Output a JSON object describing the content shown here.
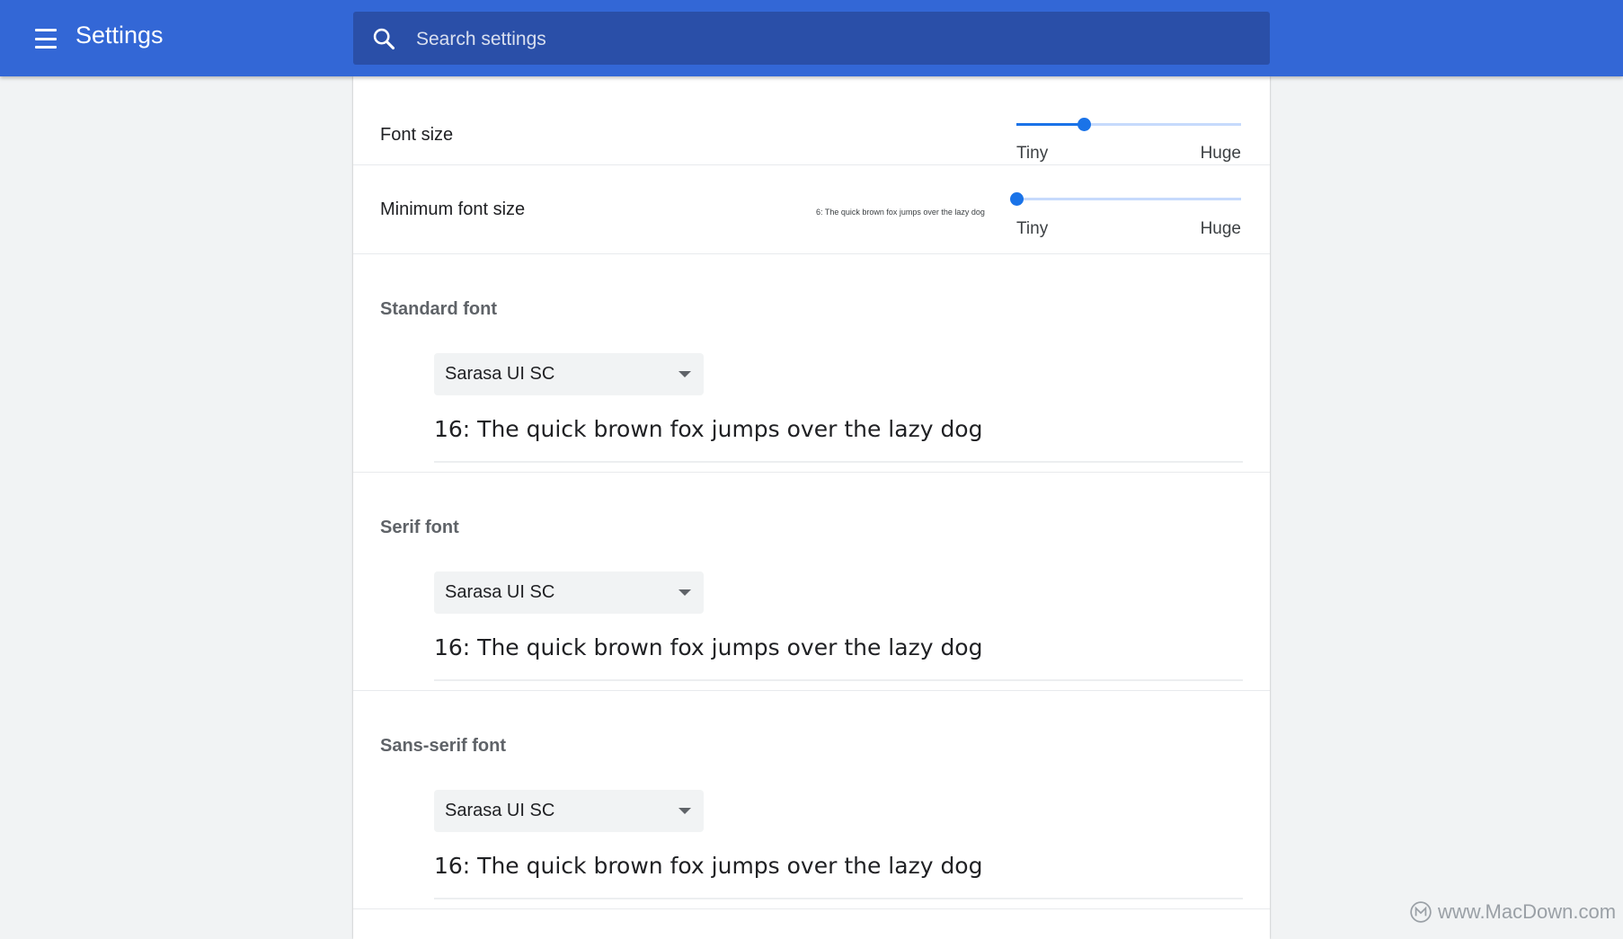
{
  "header": {
    "title": "Settings",
    "search_placeholder": "Search settings"
  },
  "font_size": {
    "label": "Font size",
    "min_label": "Tiny",
    "max_label": "Huge",
    "level": 0.3
  },
  "minimum_font_size": {
    "label": "Minimum font size",
    "preview": "6: The quick brown fox jumps over the lazy dog",
    "min_label": "Tiny",
    "max_label": "Huge",
    "level": 0.0
  },
  "fonts": [
    {
      "title": "Standard font",
      "selected": "Sarasa UI SC",
      "sample": "16: The quick brown fox jumps over the lazy dog"
    },
    {
      "title": "Serif font",
      "selected": "Sarasa UI SC",
      "sample": "16: The quick brown fox jumps over the lazy dog"
    },
    {
      "title": "Sans-serif font",
      "selected": "Sarasa UI SC",
      "sample": "16: The quick brown fox jumps over the lazy dog"
    }
  ],
  "watermark": "www.MacDown.com",
  "colors": {
    "header": "#3367d6",
    "search": "#2a4fa8",
    "accent": "#1a73e8"
  },
  "icons": {
    "menu": "menu-icon",
    "search": "search-icon",
    "dropdown": "chevron-down-icon"
  }
}
